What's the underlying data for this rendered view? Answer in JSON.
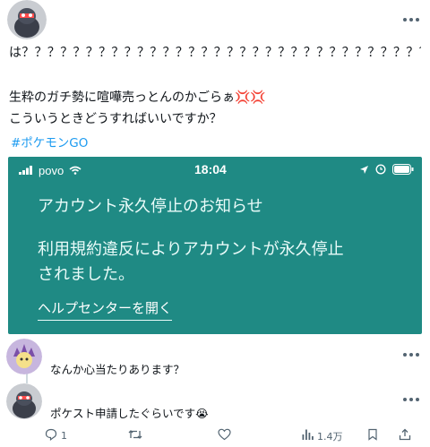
{
  "post": {
    "text_line1": "は？？？？？？？？？？？？？？？？？？？？？？？？？？？？？？？？？？？？？？？？？？？？？？？？？？？？？？？？？？？？？？？？？？？？",
    "text_line2": "生粋のガチ勢に喧嘩売っとんのかごらぁ💢💢",
    "text_line3": "こういうときどうすればいいですか？",
    "hashtag": "#ポケモンGO"
  },
  "screenshot": {
    "carrier": "povo",
    "time": "18:04",
    "heading": "アカウント永久停止のお知らせ",
    "message_line1": "利用規約違反によりアカウントが永久停止",
    "message_line2": "されました。",
    "help_link": "ヘルプセンターを開く",
    "background_color": "#1f8a84"
  },
  "replies": [
    {
      "text": "なんか心当たりあります？"
    },
    {
      "text": "ポケスト申請したぐらいです😭"
    }
  ],
  "actions": {
    "reply_count": "1",
    "retweet_count": "",
    "like_count": "",
    "views_count": "1.4万"
  },
  "icons": [
    "more-icon",
    "wifi-icon",
    "location-icon",
    "alarm-icon",
    "battery-icon",
    "reply-icon",
    "retweet-icon",
    "like-icon",
    "views-icon",
    "bookmark-icon",
    "share-icon"
  ]
}
